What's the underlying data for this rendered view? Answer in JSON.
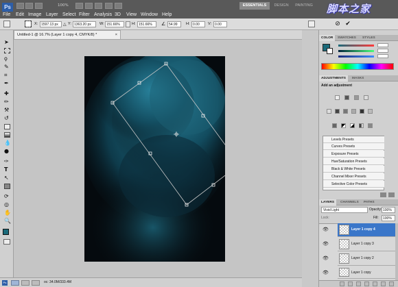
{
  "app": {
    "logo": "Ps",
    "zoom": "100%"
  },
  "menu": [
    "File",
    "Edit",
    "Image",
    "Layer",
    "Select",
    "Filter",
    "Analysis",
    "3D",
    "View",
    "Window",
    "Help"
  ],
  "workspaces": [
    "ESSENTIALS",
    "DESIGN",
    "PAINTING"
  ],
  "watermark": "脚本之家",
  "options": {
    "x_label": "X:",
    "x_value": "1597.13 px",
    "y_label": "Y:",
    "y_value": "1363.20 px",
    "w_label": "W:",
    "w_value": "151.66%",
    "h_label": "H:",
    "h_value": "151.66%",
    "angle_value": "54.99",
    "hskew_label": "H:",
    "hskew_value": "0.00",
    "vskew_label": "V:",
    "vskew_value": "0.00"
  },
  "document": {
    "tab_title": "Untitled-1 @ 16.7% (Layer 1 copy 4, CMYK/8) *",
    "close": "×"
  },
  "status": {
    "doc_info": "oc: 34.0M/333.4M"
  },
  "color_panel": {
    "tabs": [
      "COLOR",
      "SWATCHES",
      "STYLES"
    ],
    "fg_color": "#1a6a7a",
    "bg_color": "#ffffff"
  },
  "adjustments_panel": {
    "tabs": [
      "ADJUSTMENTS",
      "MASKS"
    ],
    "heading": "Add an adjustment",
    "presets": [
      "Levels Presets",
      "Curves Presets",
      "Exposure Presets",
      "Hue/Saturation Presets",
      "Black & White Presets",
      "Channel Mixer Presets",
      "Selective Color Presets"
    ]
  },
  "layers_panel": {
    "tabs": [
      "LAYERS",
      "CHANNELS",
      "PATHS"
    ],
    "blend_mode": "Vivid Light",
    "opacity_label": "Opacity:",
    "opacity_value": "100%",
    "fill_label": "Fill:",
    "fill_value": "100%",
    "lock_label": "Lock:",
    "layers": [
      {
        "name": "Layer 1 copy 4",
        "selected": true
      },
      {
        "name": "Layer 1 copy 3",
        "selected": false
      },
      {
        "name": "Layer 1 copy 2",
        "selected": false
      },
      {
        "name": "Layer 1 copy",
        "selected": false
      }
    ]
  },
  "colors": {
    "selection_blue": "#3a76c9",
    "teal_glow": "#1f6f86"
  }
}
